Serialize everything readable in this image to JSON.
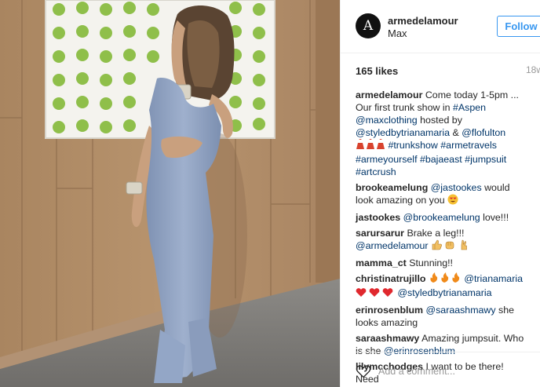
{
  "post": {
    "username": "armedelamour",
    "avatar_letter": "A",
    "location": "Max",
    "follow_label": "Follow",
    "likes": "165 likes",
    "timestamp": "18w"
  },
  "caption": {
    "user": "armedelamour",
    "text1": "Come today 1-5pm ... Our first trunk show in",
    "tag_aspen": "#Aspen",
    "mention_maxclothing": "@maxclothing",
    "text2": "hosted by",
    "mention_styled": "@styledbytrianamaria",
    "text3": "&",
    "mention_flofulton": "@flofulton",
    "tag_trunkshow": "#trunkshow",
    "tag_armetravels": "#armetravels",
    "tag_armeyourself": "#armeyourself",
    "tag_bajaeast": "#bajaeast",
    "tag_jumpsuit": "#jumpsuit",
    "tag_artcrush": "#artcrush"
  },
  "comments": [
    {
      "user": "brookeamelung",
      "mention": "@jastookes",
      "text": "would look amazing on you"
    },
    {
      "user": "jastookes",
      "mention": "@brookeamelung",
      "text": "love!!!"
    },
    {
      "user": "sarursarur",
      "text": "Brake a leg!!!",
      "mention": "@armedelamour"
    },
    {
      "user": "mamma_ct",
      "text": "Stunning!!"
    },
    {
      "user": "christinatrujillo",
      "mention": "@trianamaria",
      "mention2": "@styledbytrianamaria"
    },
    {
      "user": "erinrosenblum",
      "mention": "@saraashmawy",
      "text": "she looks amazing"
    },
    {
      "user": "saraashmawy",
      "text": "Amazing jumpsuit. Who is she",
      "mention": "@erinrosenblum"
    },
    {
      "user": "lilymcchodges",
      "text": "I want to be there! Need"
    }
  ],
  "add_comment_placeholder": "Add a comment...",
  "icons": {
    "heart": "heart-icon",
    "avatar": "avatar"
  },
  "colors": {
    "follow_blue": "#3897f0",
    "mention_blue": "#003569",
    "muted": "#999999"
  }
}
